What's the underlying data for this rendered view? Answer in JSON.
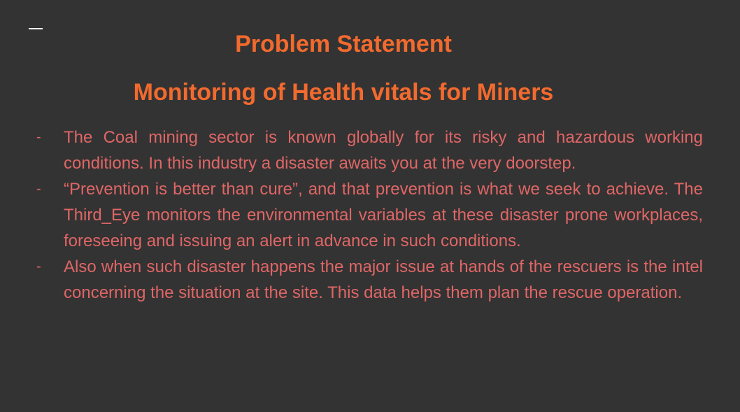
{
  "slide": {
    "title": "Problem Statement",
    "subtitle": "Monitoring of Health vitals for Miners",
    "bullet_marker": "-",
    "bullets": [
      "The Coal mining sector is known globally for its risky and hazardous working conditions. In this industry a disaster awaits you at the very doorstep.",
      "“Prevention is better than cure”, and that prevention is what we seek to achieve. The Third_Eye monitors the environmental variables at these disaster prone workplaces, foreseeing and issuing an alert in advance in such conditions.",
      "Also when such disaster happens the major issue at hands of the rescuers is the intel concerning the situation at the site. This data helps them plan the rescue operation."
    ]
  },
  "colors": {
    "background": "#333333",
    "heading": "#f26a2e",
    "body_text": "#e06666",
    "accent_dash": "#ffffff"
  }
}
